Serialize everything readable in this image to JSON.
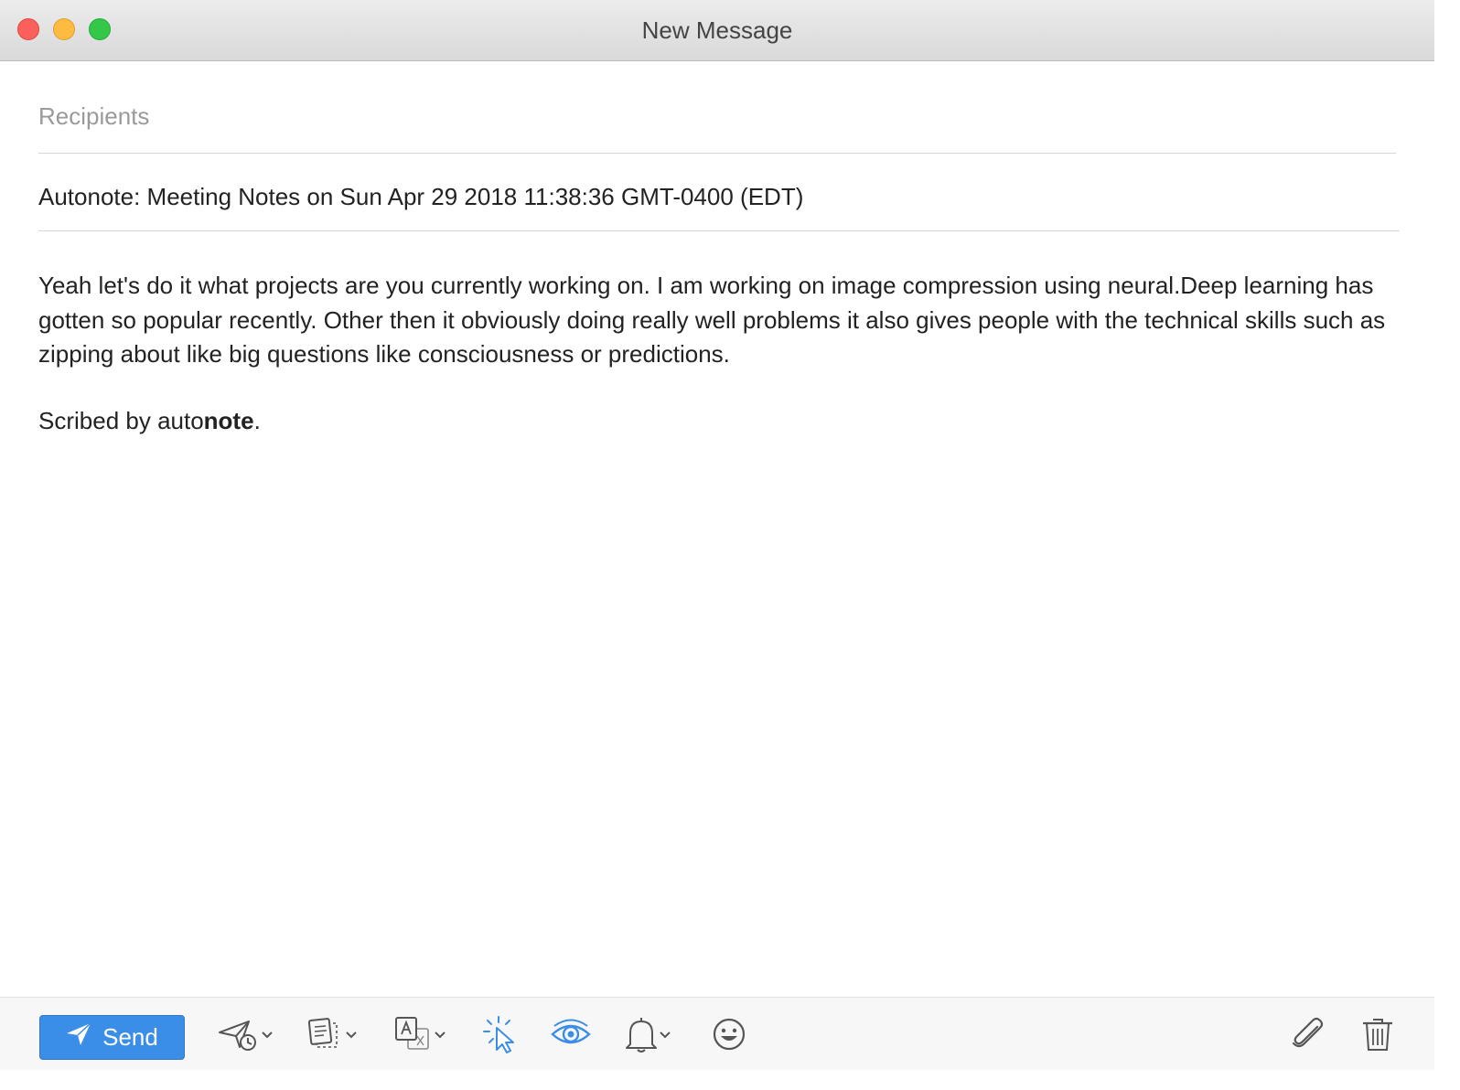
{
  "window": {
    "title": "New Message"
  },
  "compose": {
    "recipients_placeholder": "Recipients",
    "subject": "Autonote: Meeting Notes on Sun Apr 29 2018 11:38:36 GMT-0400 (EDT)",
    "body": "Yeah let's do it what projects are you currently working on. I am working on image compression using neural.Deep learning has gotten so popular recently. Other then it obviously doing really well problems it also gives people with the technical skills such as zipping about like big questions like consciousness or predictions.",
    "signature_prefix": "Scribed by auto",
    "signature_bold": "note",
    "signature_suffix": "."
  },
  "toolbar": {
    "send_label": "Send",
    "tools": [
      "send-later-icon",
      "templates-icon",
      "translate-icon",
      "link-tracking-icon",
      "read-receipt-icon",
      "reminder-bell-icon",
      "emoji-icon",
      "attachment-icon",
      "trash-icon"
    ]
  },
  "colors": {
    "accent": "#3b8ee8",
    "icon_gray": "#555555",
    "icon_active": "#3b8ee8"
  }
}
